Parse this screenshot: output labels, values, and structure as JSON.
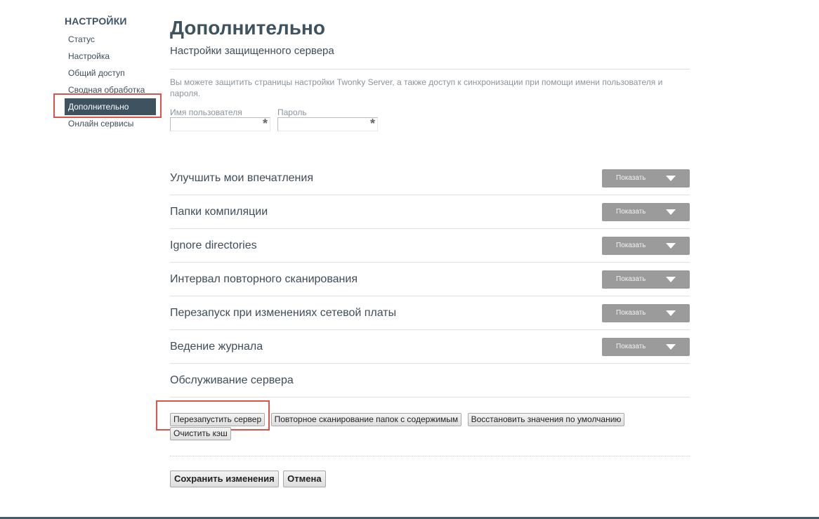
{
  "sidebar": {
    "heading": "НАСТРОЙКИ",
    "items": [
      {
        "label": "Статус"
      },
      {
        "label": "Настройка"
      },
      {
        "label": "Общий доступ"
      },
      {
        "label": "Сводная обработка"
      },
      {
        "label": "Дополнительно",
        "active": true
      },
      {
        "label": "Онлайн сервисы"
      }
    ]
  },
  "page": {
    "title": "Дополнительно",
    "subtitle": "Настройки защищенного сервера",
    "description": "Вы можете защитить страницы настройки Twonky Server, а также доступ к синхронизации при помощи имени пользователя и пароля."
  },
  "credentials": {
    "username_label": "Имя пользователя",
    "username_value": "",
    "password_label": "Пароль",
    "password_value": "",
    "required_mark": "*"
  },
  "sections": [
    {
      "title": "Улучшить мои впечатления",
      "button": "Показать"
    },
    {
      "title": "Папки компиляции",
      "button": "Показать"
    },
    {
      "title": "Ignore directories",
      "button": "Показать"
    },
    {
      "title": "Интервал повторного сканирования",
      "button": "Показать"
    },
    {
      "title": "Перезапуск при изменениях сетевой платы",
      "button": "Показать"
    },
    {
      "title": "Ведение журнала",
      "button": "Показать"
    }
  ],
  "maintenance": {
    "title": "Обслуживание сервера",
    "restart": "Перезапустить сервер",
    "rescan": "Повторное сканирование папок с содержимым",
    "restore": "Восстановить значения по умолчанию",
    "clear_cache": "Очистить кэш"
  },
  "actions": {
    "save": "Сохранить изменения",
    "cancel": "Отмена"
  },
  "colors": {
    "accent": "#3e5260",
    "highlight": "#d9534f",
    "show_button": "#9b9b9b"
  }
}
